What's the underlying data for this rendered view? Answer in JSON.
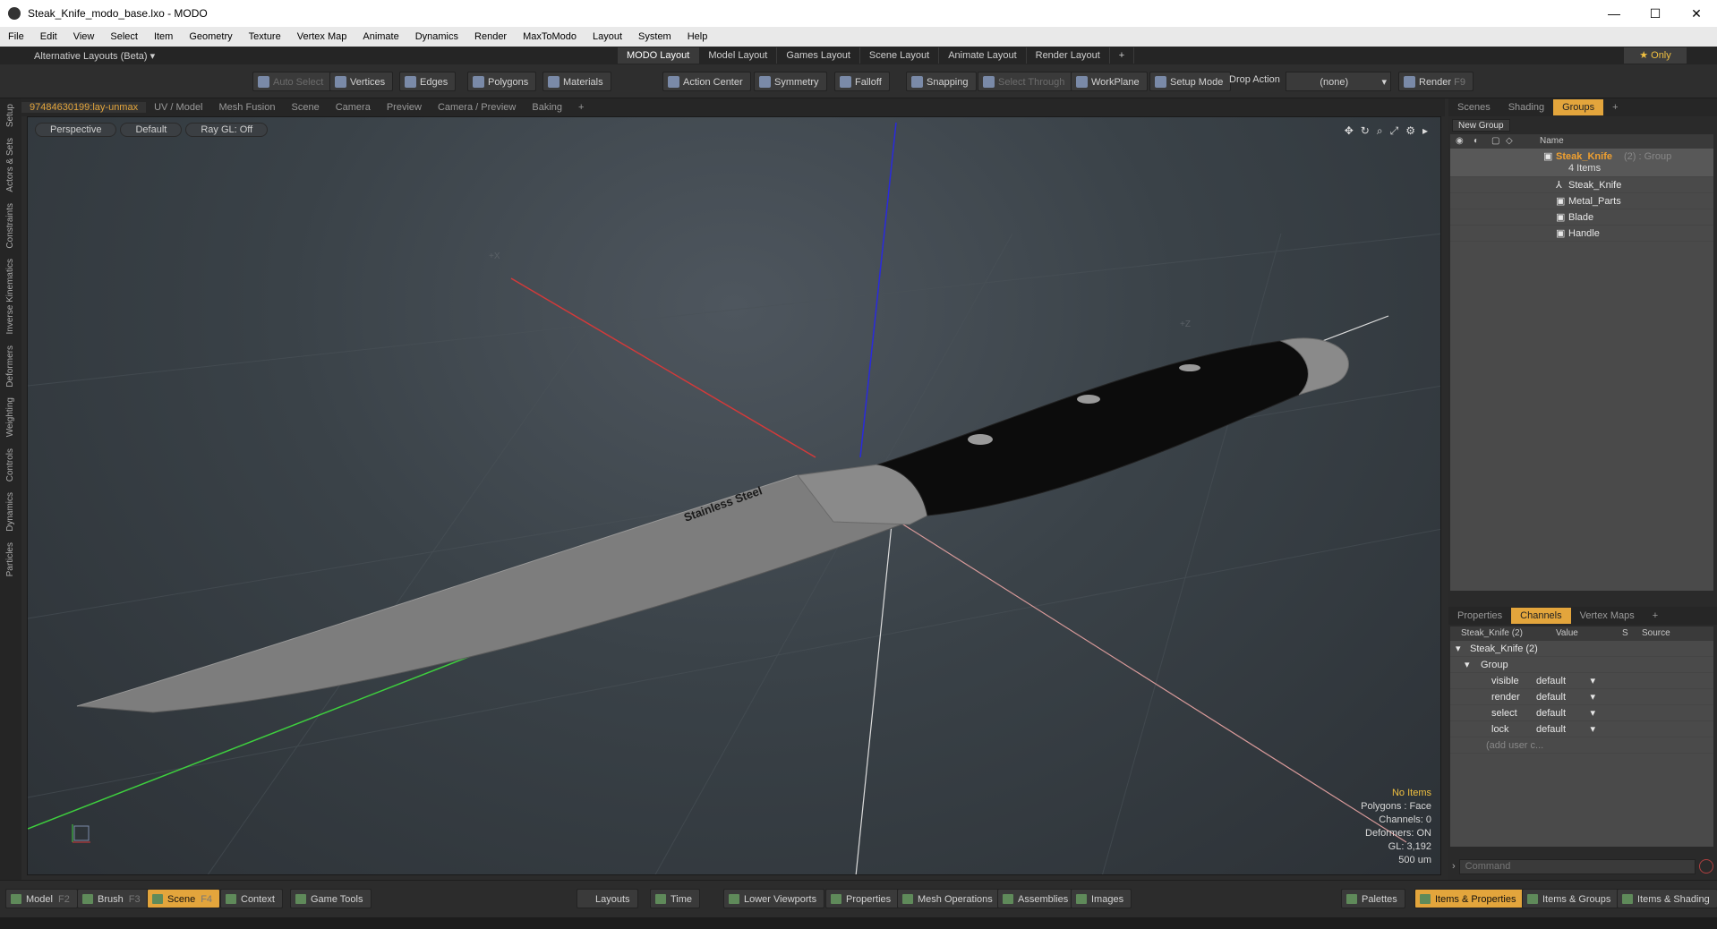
{
  "window": {
    "title": "Steak_Knife_modo_base.lxo - MODO",
    "minimize": "—",
    "maximize": "☐",
    "close": "✕"
  },
  "menu": [
    "File",
    "Edit",
    "View",
    "Select",
    "Item",
    "Geometry",
    "Texture",
    "Vertex Map",
    "Animate",
    "Dynamics",
    "Render",
    "MaxToModo",
    "Layout",
    "System",
    "Help"
  ],
  "layouts": {
    "alt_label": "Alternative Layouts (Beta) ▾",
    "tabs": [
      "MODO Layout",
      "Model Layout",
      "Games Layout",
      "Scene Layout",
      "Animate Layout",
      "Render Layout"
    ],
    "add": "+",
    "only": "★ Only"
  },
  "toolbar": {
    "auto_select": "Auto Select",
    "vertices": "Vertices",
    "edges": "Edges",
    "polygons": "Polygons",
    "materials": "Materials",
    "action_center": "Action Center",
    "symmetry": "Symmetry",
    "falloff": "Falloff",
    "snapping": "Snapping",
    "select_through": "Select Through",
    "workplane": "WorkPlane",
    "setup_mode": "Setup Mode",
    "drop_action": "Drop Action",
    "drop_value": "(none)",
    "render": "Render",
    "render_key": "F9"
  },
  "left_tabs": [
    "Setup",
    "Actors & Sets",
    "Constraints",
    "Inverse Kinematics",
    "Deformers",
    "Weighting",
    "Controls",
    "Dynamics",
    "Particles"
  ],
  "viewport_tabs": [
    "97484630199:lay-unmax",
    "UV / Model",
    "Mesh Fusion",
    "Scene",
    "Camera",
    "Preview",
    "Camera / Preview",
    "Baking",
    "+"
  ],
  "viewport": {
    "perspective": "Perspective",
    "default": "Default",
    "raygl": "Ray GL: Off",
    "blade_text": "Stainless Steel",
    "axis_x": "+X",
    "axis_z": "+Z",
    "hud": {
      "items": "No Items",
      "polygons": "Polygons : Face",
      "channels": "Channels: 0",
      "deformers": "Deformers: ON",
      "gl": "GL: 3,192",
      "scale": "500 um"
    }
  },
  "groups_panel": {
    "tabs": [
      "Scenes",
      "Shading",
      "Groups",
      "+"
    ],
    "new_group": "New Group",
    "name_header": "Name",
    "group_name": "Steak_Knife",
    "group_suffix": "(2) : Group",
    "group_count": "4 Items",
    "children": [
      "Steak_Knife",
      "Metal_Parts",
      "Blade",
      "Handle"
    ]
  },
  "channels_panel": {
    "tabs": [
      "Properties",
      "Channels",
      "Vertex Maps",
      "+"
    ],
    "headers": {
      "name": "Steak_Knife (2)",
      "value": "Value",
      "s": "S",
      "source": "Source"
    },
    "root": "Steak_Knife (2)",
    "group": "Group",
    "rows": [
      {
        "name": "visible",
        "value": "default"
      },
      {
        "name": "render",
        "value": "default"
      },
      {
        "name": "select",
        "value": "default"
      },
      {
        "name": "lock",
        "value": "default"
      }
    ],
    "add_user": "(add user c...",
    "command_placeholder": "Command"
  },
  "bottom_bar": {
    "model": "Model",
    "model_key": "F2",
    "brush": "Brush",
    "brush_key": "F3",
    "scene": "Scene",
    "scene_key": "F4",
    "context": "Context",
    "game_tools": "Game Tools",
    "layouts": "Layouts",
    "time": "Time",
    "lower_viewports": "Lower Viewports",
    "properties": "Properties",
    "mesh_operations": "Mesh Operations",
    "assemblies": "Assemblies",
    "images": "Images",
    "palettes": "Palettes",
    "items_properties": "Items & Properties",
    "items_groups": "Items & Groups",
    "items_shading": "Items & Shading"
  },
  "colors": {
    "accent": "#e3a53c",
    "axis_x": "#d23a3a",
    "axis_y": "#2a2adc",
    "axis_z": "#3ecf3e"
  }
}
